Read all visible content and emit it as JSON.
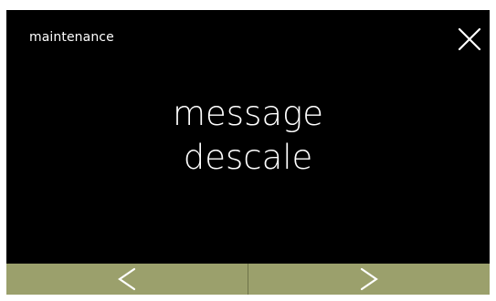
{
  "header": {
    "title": "maintenance",
    "close_icon": "close-icon"
  },
  "message": {
    "line1": "message",
    "line2": "descale"
  },
  "footer": {
    "prev_icon": "chevron-left-icon",
    "next_icon": "chevron-right-icon"
  },
  "colors": {
    "screen_background": "#000000",
    "text": "#ffffff",
    "footer_background": "#9ba06c",
    "footer_divider": "#6f7449"
  }
}
